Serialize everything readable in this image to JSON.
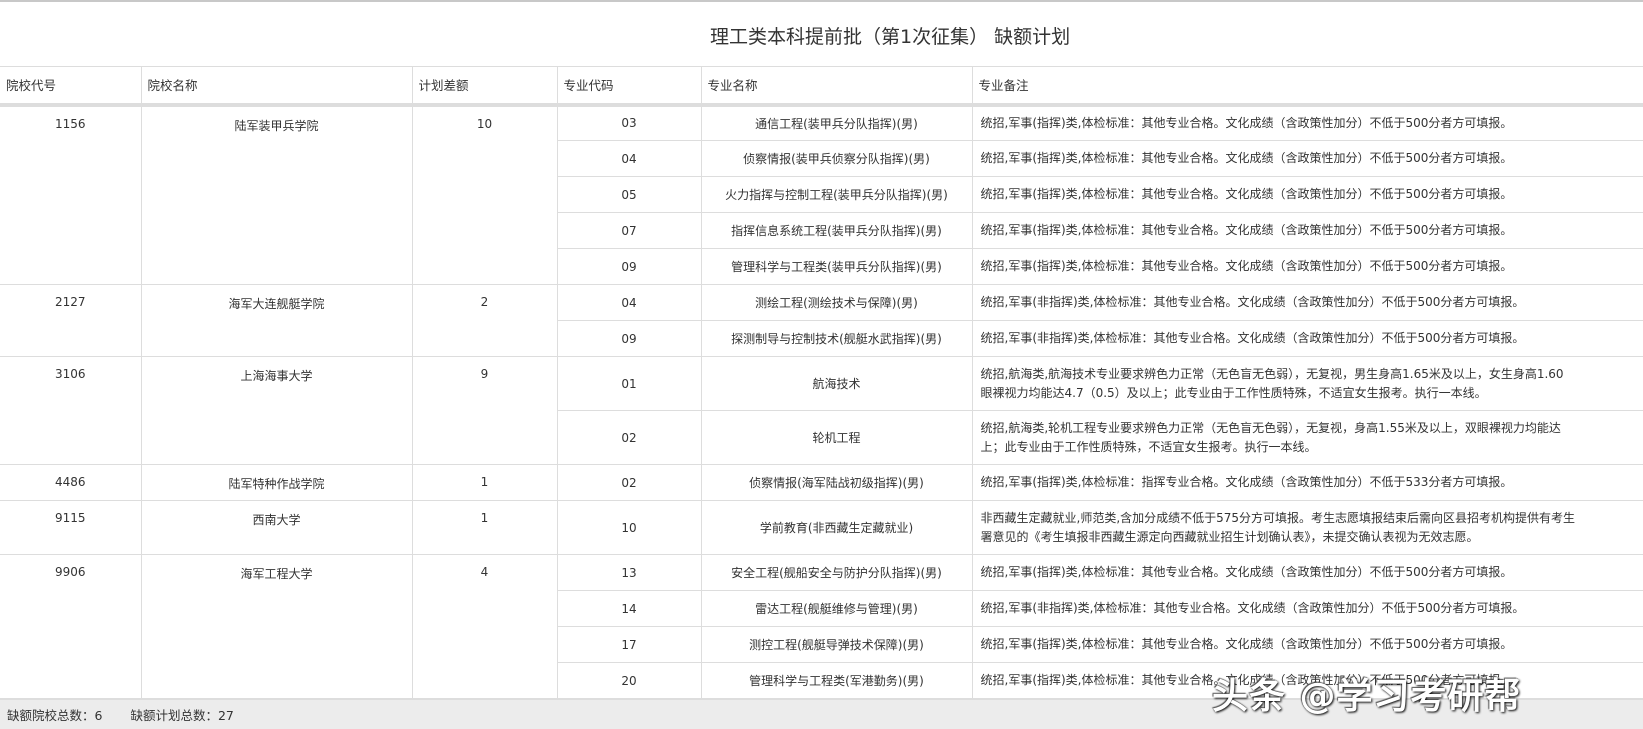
{
  "title": "理工类本科提前批（第1次征集） 缺额计划",
  "headers": [
    "院校代号",
    "院校名称",
    "计划差额",
    "专业代码",
    "专业名称",
    "专业备注"
  ],
  "schools": [
    {
      "code": "1156",
      "name": "陆军装甲兵学院",
      "diff": "10",
      "majors": [
        {
          "code": "03",
          "name": "通信工程(装甲兵分队指挥)(男)",
          "note": "统招,军事(指挥)类,体检标准：其他专业合格。文化成绩（含政策性加分）不低于500分者方可填报。"
        },
        {
          "code": "04",
          "name": "侦察情报(装甲兵侦察分队指挥)(男)",
          "note": "统招,军事(指挥)类,体检标准：其他专业合格。文化成绩（含政策性加分）不低于500分者方可填报。"
        },
        {
          "code": "05",
          "name": "火力指挥与控制工程(装甲兵分队指挥)(男)",
          "note": "统招,军事(指挥)类,体检标准：其他专业合格。文化成绩（含政策性加分）不低于500分者方可填报。"
        },
        {
          "code": "07",
          "name": "指挥信息系统工程(装甲兵分队指挥)(男)",
          "note": "统招,军事(指挥)类,体检标准：其他专业合格。文化成绩（含政策性加分）不低于500分者方可填报。"
        },
        {
          "code": "09",
          "name": "管理科学与工程类(装甲兵分队指挥)(男)",
          "note": "统招,军事(指挥)类,体检标准：其他专业合格。文化成绩（含政策性加分）不低于500分者方可填报。"
        }
      ]
    },
    {
      "code": "2127",
      "name": "海军大连舰艇学院",
      "diff": "2",
      "majors": [
        {
          "code": "04",
          "name": "测绘工程(测绘技术与保障)(男)",
          "note": "统招,军事(非指挥)类,体检标准：其他专业合格。文化成绩（含政策性加分）不低于500分者方可填报。"
        },
        {
          "code": "09",
          "name": "探测制导与控制技术(舰艇水武指挥)(男)",
          "note": "统招,军事(非指挥)类,体检标准：其他专业合格。文化成绩（含政策性加分）不低于500分者方可填报。"
        }
      ]
    },
    {
      "code": "3106",
      "name": "上海海事大学",
      "diff": "9",
      "majors": [
        {
          "code": "01",
          "name": "航海技术",
          "note": "统招,航海类,航海技术专业要求辨色力正常（无色盲无色弱），无复视，男生身高1.65米及以上，女生身高1.60",
          "note2": "眼裸视力均能达4.7（0.5）及以上；此专业由于工作性质特殊，不适宜女生报考。执行一本线。"
        },
        {
          "code": "02",
          "name": "轮机工程",
          "note": "统招,航海类,轮机工程专业要求辨色力正常（无色盲无色弱），无复视，身高1.55米及以上，双眼裸视力均能达",
          "note2": "上；此专业由于工作性质特殊，不适宜女生报考。执行一本线。"
        }
      ]
    },
    {
      "code": "4486",
      "name": "陆军特种作战学院",
      "diff": "1",
      "majors": [
        {
          "code": "02",
          "name": "侦察情报(海军陆战初级指挥)(男)",
          "note": "统招,军事(指挥)类,体检标准：指挥专业合格。文化成绩（含政策性加分）不低于533分者方可填报。"
        }
      ]
    },
    {
      "code": "9115",
      "name": "西南大学",
      "diff": "1",
      "majors": [
        {
          "code": "10",
          "name": "学前教育(非西藏生定藏就业)",
          "note": "非西藏生定藏就业,师范类,含加分成绩不低于575分方可填报。考生志愿填报结束后需向区县招考机构提供有考生",
          "note2": "署意见的《考生填报非西藏生源定向西藏就业招生计划确认表》，未提交确认表视为无效志愿。"
        }
      ]
    },
    {
      "code": "9906",
      "name": "海军工程大学",
      "diff": "4",
      "majors": [
        {
          "code": "13",
          "name": "安全工程(舰船安全与防护分队指挥)(男)",
          "note": "统招,军事(指挥)类,体检标准：其他专业合格。文化成绩（含政策性加分）不低于500分者方可填报。"
        },
        {
          "code": "14",
          "name": "雷达工程(舰艇维修与管理)(男)",
          "note": "统招,军事(非指挥)类,体检标准：其他专业合格。文化成绩（含政策性加分）不低于500分者方可填报。"
        },
        {
          "code": "17",
          "name": "测控工程(舰艇导弹技术保障)(男)",
          "note": "统招,军事(指挥)类,体检标准：其他专业合格。文化成绩（含政策性加分）不低于500分者方可填报。"
        },
        {
          "code": "20",
          "name": "管理科学与工程类(军港勤务)(男)",
          "note": "统招,军事(指挥)类,体检标准：其他专业合格。文化成绩（含政策性加分）不低于500分者方可填报。"
        }
      ]
    }
  ],
  "footer": {
    "schools_label": "缺额院校总数：6",
    "plan_label": "缺额计划总数：27"
  },
  "watermark": "头条 @学习考研帮"
}
